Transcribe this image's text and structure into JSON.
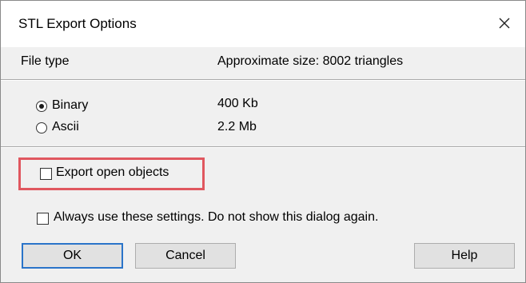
{
  "window": {
    "title": "STL Export Options"
  },
  "file_type": {
    "label": "File type",
    "approx_size": "Approximate size: 8002 triangles",
    "options": [
      {
        "label": "Binary",
        "size": "400 Kb",
        "selected": true
      },
      {
        "label": "Ascii",
        "size": "2.2 Mb",
        "selected": false
      }
    ]
  },
  "export_open_objects": {
    "label": "Export open objects",
    "checked": false
  },
  "always_use": {
    "label": "Always use these settings. Do not show this dialog again.",
    "checked": false
  },
  "buttons": {
    "ok": "OK",
    "cancel": "Cancel",
    "help": "Help"
  },
  "colors": {
    "highlight": "#e0575f",
    "default_button_border": "#2a74c9"
  },
  "icons": {
    "close": "close-icon"
  }
}
